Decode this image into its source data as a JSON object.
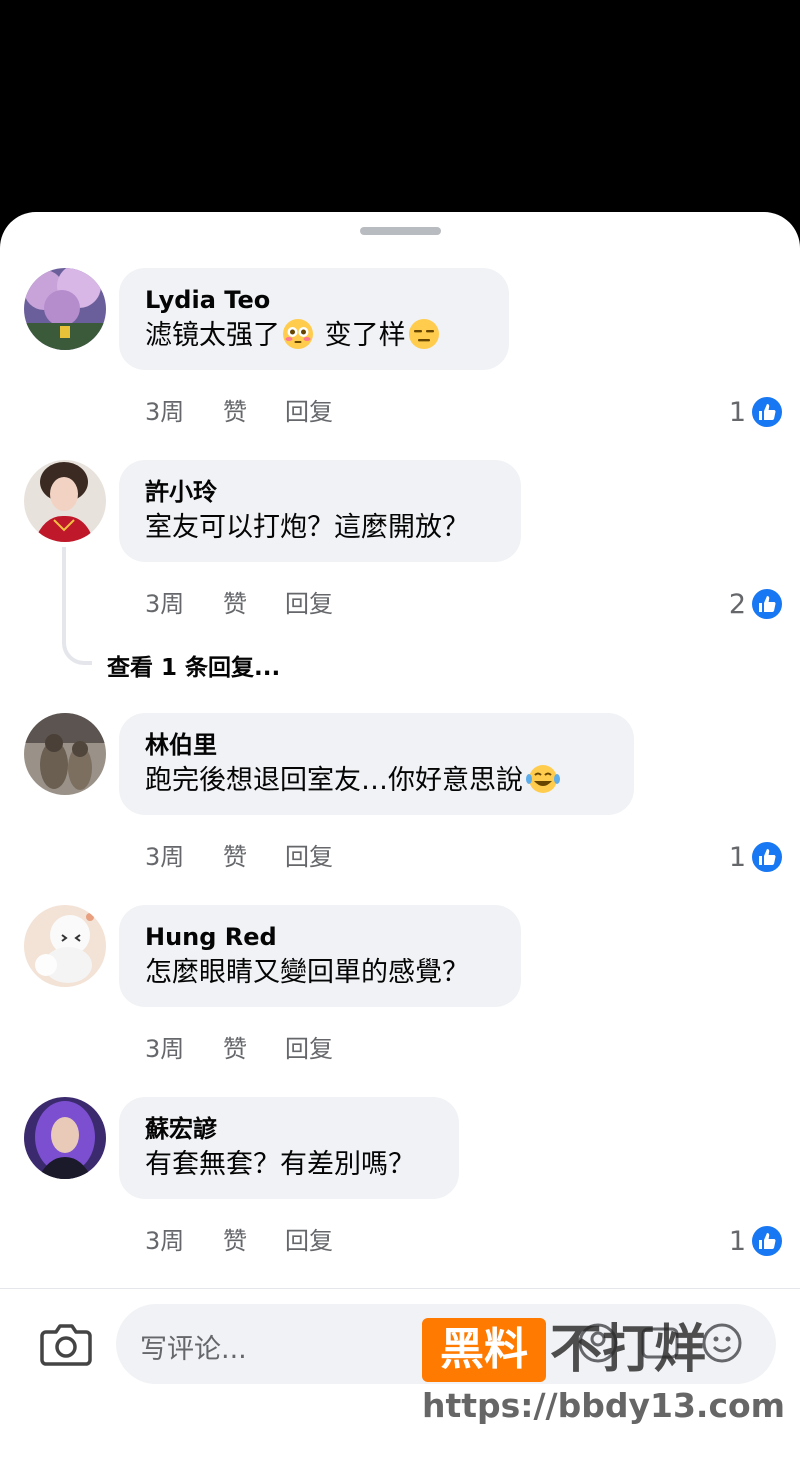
{
  "comments": [
    {
      "author": "Lydia Teo",
      "parts": [
        "滤镜太强了",
        "flushed",
        " 变了样",
        "expressionless"
      ],
      "time": "3周",
      "like": "赞",
      "reply": "回复",
      "likes": "1"
    },
    {
      "author": "許小玲",
      "parts": [
        "室友可以打炮？這麼開放？"
      ],
      "time": "3周",
      "like": "赞",
      "reply": "回复",
      "likes": "2"
    },
    {
      "author": "林伯里",
      "parts": [
        "跑完後想退回室友…你好意思說",
        "joy"
      ],
      "time": "3周",
      "like": "赞",
      "reply": "回复",
      "likes": "1"
    },
    {
      "author": "Hung Red",
      "parts": [
        "怎麼眼睛又變回單的感覺？"
      ],
      "time": "3周",
      "like": "赞",
      "reply": "回复",
      "likes": ""
    },
    {
      "author": "蘇宏諺",
      "parts": [
        "有套無套？有差別嗎？"
      ],
      "time": "3周",
      "like": "赞",
      "reply": "回复",
      "likes": "1"
    }
  ],
  "view_replies": "查看 1 条回复...",
  "composer": {
    "placeholder": "写评论..."
  },
  "watermark": {
    "badge": "黑料",
    "dark": "不打烊",
    "url": "https://bbdy13.com"
  },
  "colors": {
    "like_blue": "#1877f2",
    "bubble": "#f0f2f5",
    "watermark_orange": "#ff7a00"
  }
}
